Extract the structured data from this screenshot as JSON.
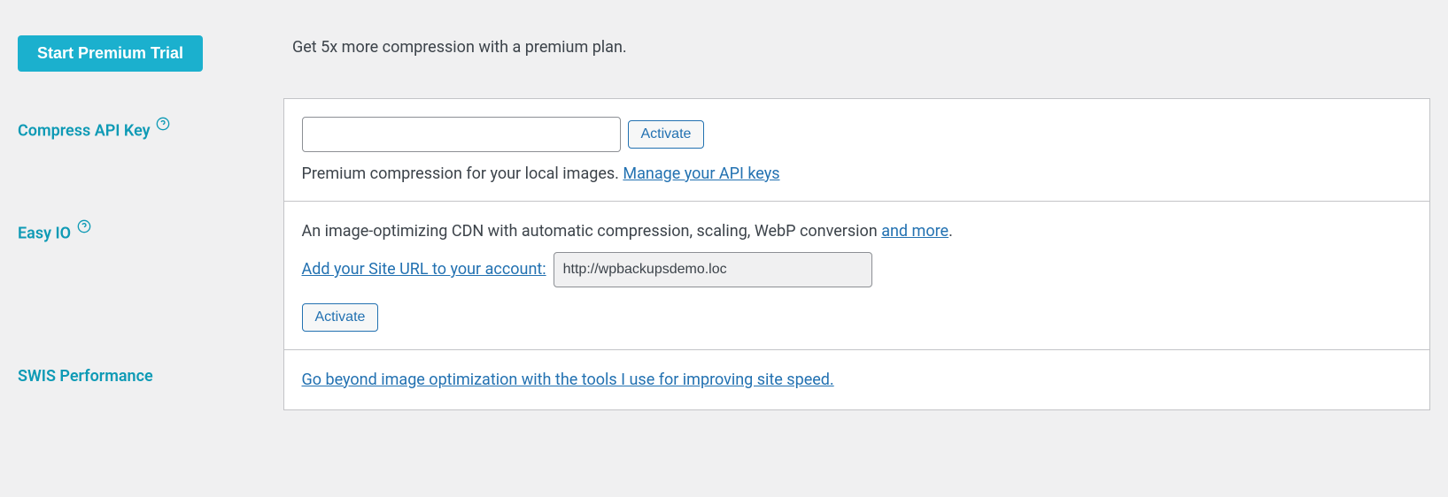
{
  "premium": {
    "btn_label": "Start Premium Trial",
    "description": "Get 5x more compression with a premium plan."
  },
  "compress": {
    "label": "Compress API Key",
    "activate_label": "Activate",
    "desc_prefix": "Premium compression for your local images. ",
    "manage_link": "Manage your API keys"
  },
  "easyio": {
    "label": "Easy IO",
    "desc_prefix": "An image-optimizing CDN with automatic compression, scaling, WebP conversion ",
    "and_more_link": "and more",
    "desc_suffix": ".",
    "add_url_link": "Add your Site URL to your account:",
    "url_value": "http://wpbackupsdemo.loc",
    "activate_label": "Activate"
  },
  "swis": {
    "label": "SWIS Performance",
    "link_text": "Go beyond image optimization with the tools I use for improving site speed."
  }
}
